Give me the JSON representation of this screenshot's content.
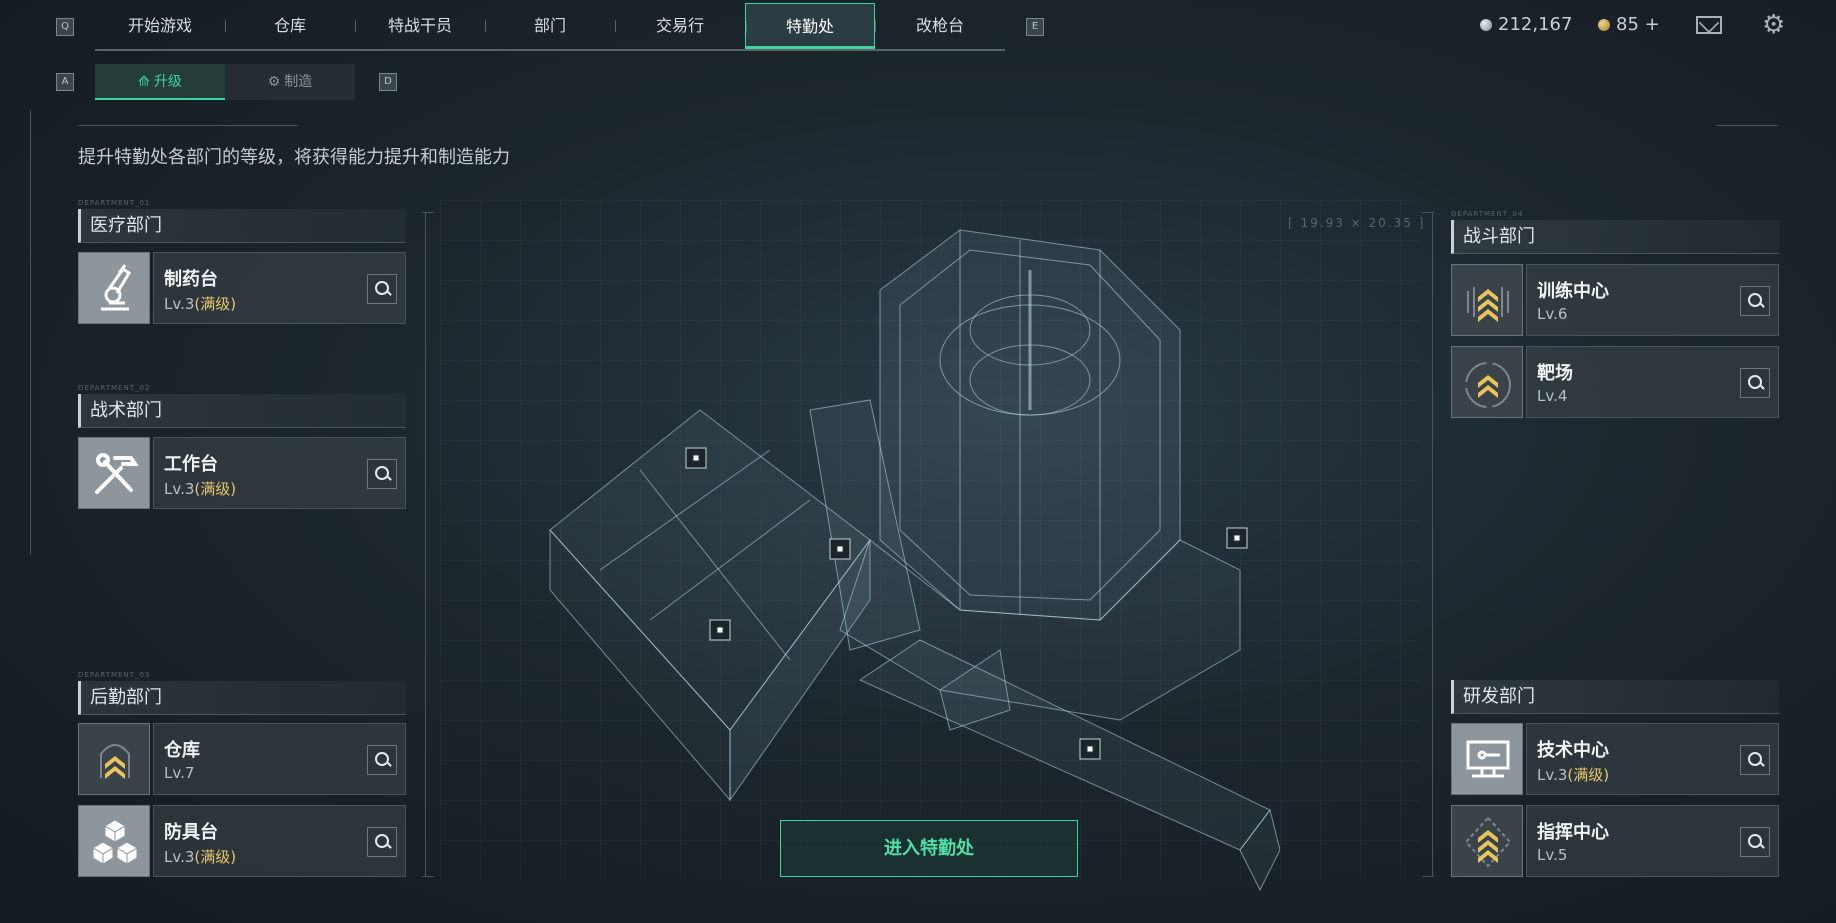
{
  "nav": {
    "left_key": "Q",
    "right_key": "E",
    "tabs": [
      {
        "label": "开始游戏"
      },
      {
        "label": "仓库"
      },
      {
        "label": "特战干员"
      },
      {
        "label": "部门"
      },
      {
        "label": "交易行"
      },
      {
        "label": "特勤处"
      },
      {
        "label": "改枪台"
      }
    ],
    "active_tab": "特勤处"
  },
  "currency": {
    "silver": "212,167",
    "gold": "85 +"
  },
  "subtabs": {
    "left_key": "A",
    "right_key": "D",
    "items": [
      {
        "label": "升级",
        "icon": "upgrade-icon"
      },
      {
        "label": "制造",
        "icon": "craft-icon"
      }
    ],
    "active": "升级"
  },
  "description": "提升特勤处各部门的等级，将获得能力提升和制造能力",
  "departments": {
    "medical": {
      "tag": "DEPARTMENT_01",
      "title": "医疗部门",
      "items": [
        {
          "name": "制药台",
          "level": "Lv.3",
          "max": "(满级)",
          "icon": "microscope-icon"
        }
      ]
    },
    "tactical": {
      "tag": "DEPARTMENT_02",
      "title": "战术部门",
      "items": [
        {
          "name": "工作台",
          "level": "Lv.3",
          "max": "(满级)",
          "icon": "tools-icon"
        }
      ]
    },
    "logistics": {
      "tag": "DEPARTMENT_03",
      "title": "后勤部门",
      "items": [
        {
          "name": "仓库",
          "level": "Lv.7",
          "max": "",
          "icon": "rank-chevron-icon"
        },
        {
          "name": "防具台",
          "level": "Lv.3",
          "max": "(满级)",
          "icon": "armor-cubes-icon"
        }
      ]
    },
    "combat": {
      "tag": "DEPARTMENT_04",
      "title": "战斗部门",
      "items": [
        {
          "name": "训练中心",
          "level": "Lv.6",
          "max": "",
          "icon": "rank-chevron-icon"
        },
        {
          "name": "靶场",
          "level": "Lv.4",
          "max": "",
          "icon": "rank-chevron-icon"
        }
      ]
    },
    "research": {
      "title": "研发部门",
      "items": [
        {
          "name": "技术中心",
          "level": "Lv.3",
          "max": "(满级)",
          "icon": "computer-icon"
        },
        {
          "name": "指挥中心",
          "level": "Lv.5",
          "max": "",
          "icon": "rank-chevron-icon"
        }
      ]
    }
  },
  "enter_button": "进入特勤处",
  "map_readout": "[ 19.93 × 20.35 ]",
  "colors": {
    "accent": "#3fd3a0",
    "max_level": "#e6c76b",
    "rank_gold": "#e8c45a"
  }
}
